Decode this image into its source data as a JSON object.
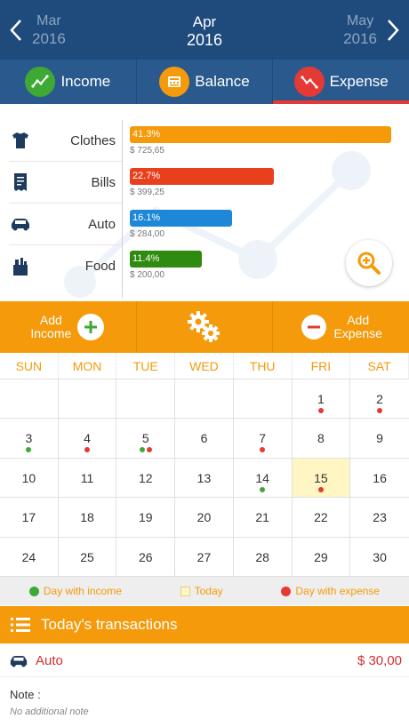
{
  "header": {
    "prev": {
      "month": "Mar",
      "year": "2016"
    },
    "current": {
      "month": "Apr",
      "year": "2016"
    },
    "next": {
      "month": "May",
      "year": "2016"
    }
  },
  "tabs": [
    {
      "label": "Income",
      "icon": "trending-up-icon",
      "color": "#3fa935"
    },
    {
      "label": "Balance",
      "icon": "calculator-icon",
      "color": "#f59a0b"
    },
    {
      "label": "Expense",
      "icon": "trending-down-icon",
      "color": "#e53935",
      "active": true
    }
  ],
  "categories": [
    {
      "label": "Clothes",
      "icon": "shirt-icon",
      "percent": "41.3%",
      "amount": "$ 725,65",
      "share": 0.413,
      "color": "#f59a0b"
    },
    {
      "label": "Bills",
      "icon": "receipt-icon",
      "percent": "22.7%",
      "amount": "$ 399,25",
      "share": 0.227,
      "color": "#e8401c"
    },
    {
      "label": "Auto",
      "icon": "car-icon",
      "percent": "16.1%",
      "amount": "$ 284,00",
      "share": 0.161,
      "color": "#1e88d8"
    },
    {
      "label": "Food",
      "icon": "groceries-icon",
      "percent": "11.4%",
      "amount": "$ 200,00",
      "share": 0.114,
      "color": "#2e8b0f"
    }
  ],
  "actions": {
    "add_income": "Add\nIncome",
    "add_income_l1": "Add",
    "add_income_l2": "Income",
    "add_expense_l1": "Add",
    "add_expense_l2": "Expense"
  },
  "calendar": {
    "weekdays": [
      "SUN",
      "MON",
      "TUE",
      "WED",
      "THU",
      "FRI",
      "SAT"
    ],
    "weeks": [
      [
        {
          "d": ""
        },
        {
          "d": ""
        },
        {
          "d": ""
        },
        {
          "d": ""
        },
        {
          "d": ""
        },
        {
          "d": "1",
          "exp": true
        },
        {
          "d": "2",
          "exp": true
        }
      ],
      [
        {
          "d": "3",
          "inc": true
        },
        {
          "d": "4",
          "exp": true
        },
        {
          "d": "5",
          "inc": true,
          "exp": true
        },
        {
          "d": "6"
        },
        {
          "d": "7",
          "exp": true
        },
        {
          "d": "8"
        },
        {
          "d": "9"
        }
      ],
      [
        {
          "d": "10"
        },
        {
          "d": "11"
        },
        {
          "d": "12"
        },
        {
          "d": "13"
        },
        {
          "d": "14",
          "inc": true
        },
        {
          "d": "15",
          "exp": true,
          "today": true
        },
        {
          "d": "16"
        }
      ],
      [
        {
          "d": "17"
        },
        {
          "d": "18"
        },
        {
          "d": "19"
        },
        {
          "d": "20"
        },
        {
          "d": "21"
        },
        {
          "d": "22"
        },
        {
          "d": "23"
        }
      ],
      [
        {
          "d": "24"
        },
        {
          "d": "25"
        },
        {
          "d": "26"
        },
        {
          "d": "27"
        },
        {
          "d": "28"
        },
        {
          "d": "29"
        },
        {
          "d": "30"
        }
      ]
    ]
  },
  "legend": {
    "income": "Day with income",
    "today": "Today",
    "expense": "Day with expense"
  },
  "transactions": {
    "title": "Today's transactions",
    "items": [
      {
        "name": "Auto",
        "amount": "$ 30,00",
        "icon": "car-icon"
      }
    ],
    "note_label": "Note :",
    "note_text": "No additional note"
  },
  "colors": {
    "header": "#1e4a7c",
    "tabs": "#2a5a8d",
    "accent": "#f59a0b",
    "income": "#3fa935",
    "expense": "#e53935",
    "today": "#fff6c4"
  }
}
